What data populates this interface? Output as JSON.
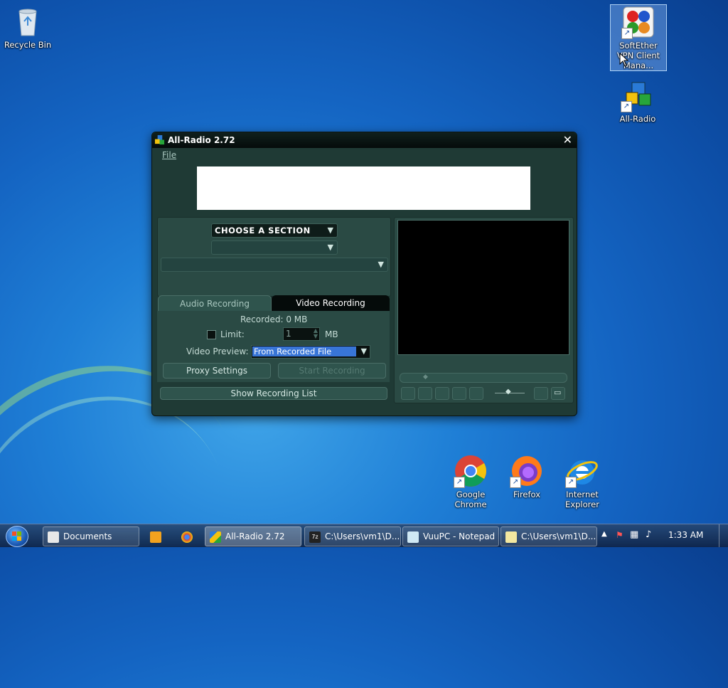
{
  "desktop": {
    "icons": [
      {
        "label": "Recycle Bin"
      },
      {
        "label": "SoftEther VPN Client Mana..."
      },
      {
        "label": "All-Radio"
      },
      {
        "label": "Google Chrome"
      },
      {
        "label": "Firefox"
      },
      {
        "label": "Internet Explorer"
      }
    ]
  },
  "window": {
    "title": "All-Radio 2.72",
    "menu_file": "File",
    "section_dropdown": "CHOOSE A SECTION",
    "tabs": {
      "audio": "Audio Recording",
      "video": "Video Recording"
    },
    "recorded": "Recorded: 0 MB",
    "limit_label": "Limit:",
    "limit_value": "1",
    "limit_unit": "MB",
    "video_preview_label": "Video Preview:",
    "video_preview_value": "From Recorded File",
    "proxy_settings": "Proxy Settings",
    "start_recording": "Start Recording",
    "show_recording_list": "Show Recording List"
  },
  "taskbar": {
    "items": [
      {
        "label": "Documents"
      },
      {
        "label": "All-Radio 2.72"
      },
      {
        "label": "C:\\Users\\vm1\\D..."
      },
      {
        "label": "VuuPC - Notepad"
      },
      {
        "label": "C:\\Users\\vm1\\D..."
      }
    ],
    "clock": "1:33 AM"
  }
}
